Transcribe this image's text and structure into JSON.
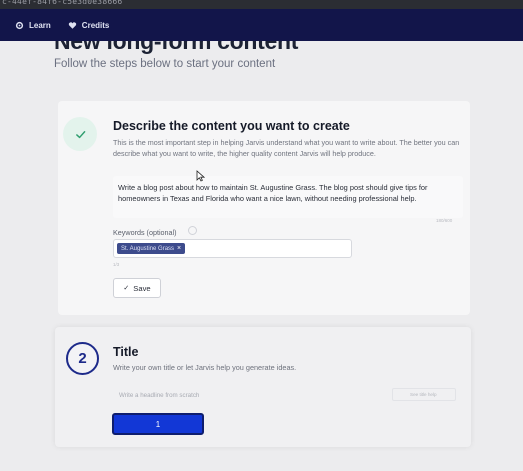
{
  "browser": {
    "url_fragment": "c-44ef-84f6-c5e3d0e38666"
  },
  "nav": {
    "items": [
      {
        "label": "Learn",
        "icon": "gear-icon"
      },
      {
        "label": "Credits",
        "icon": "heart-icon"
      }
    ]
  },
  "page": {
    "title": "New long-form content",
    "subtitle": "Follow the steps below to start your content"
  },
  "step1": {
    "title": "Describe the content you want to create",
    "description": "This is the most important step in helping Jarvis understand what you want to write about. The better you can describe what you want to write, the higher quality content Jarvis will help produce.",
    "prompt_value": "Write a blog post about how to maintain St. Augustine Grass. The blog post should give tips for homeowners in Texas and Florida who want a nice lawn, without needing professional help.",
    "char_count": "180/600",
    "keywords_label": "Keywords (optional)",
    "keyword_chip": "St. Augustine Grass",
    "keywords_hint": "1/3",
    "save_label": "Save",
    "status": "completed",
    "accent_color": "#2f9e6f"
  },
  "step2": {
    "number": "2",
    "title": "Title",
    "description": "Write your own title or let Jarvis help you generate ideas.",
    "input_placeholder": "Write a headline from scratch",
    "help_label": "See title help",
    "button_label": "1",
    "accent_color": "#1d2a8a",
    "button_color": "#1237d6"
  }
}
